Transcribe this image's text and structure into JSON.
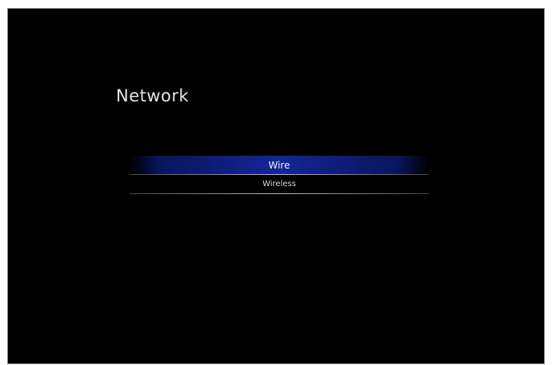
{
  "screen": {
    "title": "Network"
  },
  "menu": {
    "items": [
      {
        "label": "Wire",
        "selected": true
      },
      {
        "label": "Wireless",
        "selected": false
      }
    ]
  },
  "colors": {
    "background": "#000000",
    "highlight": "#142896",
    "text": "#d9d9d9"
  }
}
